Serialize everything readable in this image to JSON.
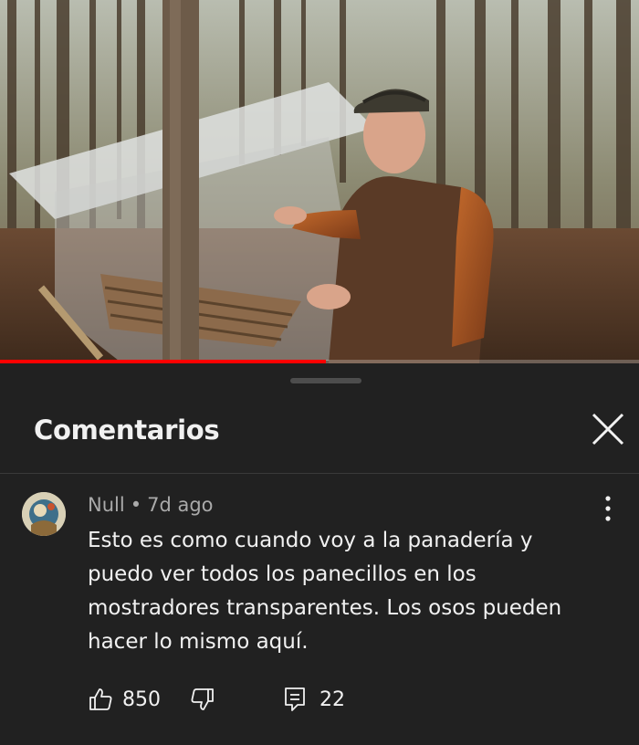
{
  "video": {
    "progress_fraction": 0.51
  },
  "comments_panel": {
    "title": "Comentarios",
    "close_icon": "close-icon"
  },
  "comment": {
    "author": "Null",
    "separator": "•",
    "time": "7d ago",
    "text": "Esto es como cuando voy a la panadería y puedo ver todos los panecillos en los mostradores transparentes. Los osos pueden hacer lo mismo aquí.",
    "likes": "850",
    "replies": "22",
    "icons": {
      "like": "thumbs-up-icon",
      "dislike": "thumbs-down-icon",
      "reply": "reply-icon",
      "more": "more-vertical-icon"
    }
  },
  "colors": {
    "background": "#212121",
    "text": "#f1f1f1",
    "secondary_text": "#aaaaaa",
    "progress": "#ff0000"
  }
}
